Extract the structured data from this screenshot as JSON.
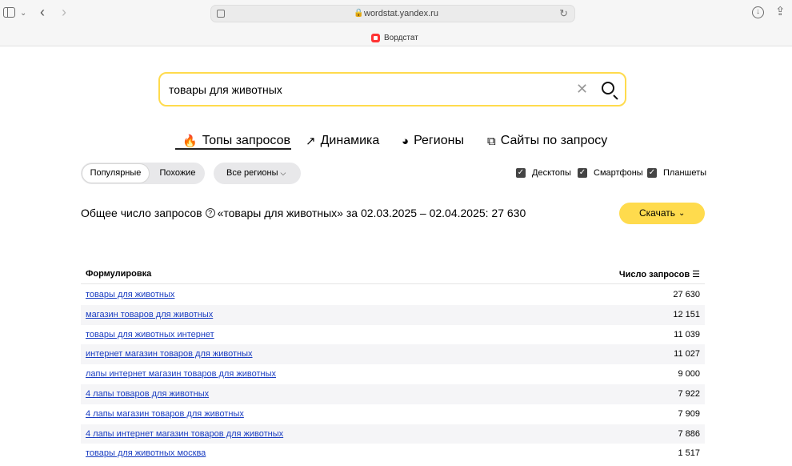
{
  "browser": {
    "url": "wordstat.yandex.ru",
    "tab_title": "Вордстат",
    "lock_glyph": "🔒",
    "reload_glyph": "↻",
    "tabs_chevron_glyph": "⌄",
    "back_glyph": "‹",
    "forward_glyph": "›",
    "download_glyph": "↓",
    "share_glyph": "⇪"
  },
  "search": {
    "query": "товары для животных",
    "clear_glyph": "✕"
  },
  "nav": {
    "tabs": [
      {
        "label": "Топы запросов",
        "icon": "fire-icon",
        "glyph": "🔥",
        "active": true
      },
      {
        "label": "Динамика",
        "icon": "trend-icon",
        "glyph": "↗"
      },
      {
        "label": "Регионы",
        "icon": "globe-icon",
        "glyph": "◕"
      },
      {
        "label": "Сайты по запросу",
        "icon": "external-link-icon",
        "glyph": "⧉"
      }
    ]
  },
  "filters": {
    "popular": "Популярные",
    "similar": "Похожие",
    "region": "Все регионы",
    "region_chevron": "⌵",
    "devices": [
      {
        "label": "Десктопы",
        "checked": true
      },
      {
        "label": "Смартфоны",
        "checked": true
      },
      {
        "label": "Планшеты",
        "checked": true
      }
    ],
    "check_glyph": "✓"
  },
  "summary": {
    "prefix": "Общее число запросов",
    "help_glyph": "?",
    "suffix": "«товары для животных» за 02.03.2025 – 02.04.2025: 27 630"
  },
  "download": {
    "label": "Скачать",
    "chevron": "⌄"
  },
  "table": {
    "col_phrase": "Формулировка",
    "col_count": "Число запросов",
    "sort_glyph": "☰",
    "rows": [
      {
        "phrase": "товары для животных",
        "count": "27 630"
      },
      {
        "phrase": "магазин товаров для животных",
        "count": "12 151"
      },
      {
        "phrase": "товары для животных интернет",
        "count": "11 039"
      },
      {
        "phrase": "интернет магазин товаров для животных",
        "count": "11 027"
      },
      {
        "phrase": "лапы интернет магазин товаров для животных",
        "count": "9 000"
      },
      {
        "phrase": "4 лапы товаров для животных",
        "count": "7 922"
      },
      {
        "phrase": "4 лапы магазин товаров для животных",
        "count": "7 909"
      },
      {
        "phrase": "4 лапы интернет магазин товаров для животных",
        "count": "7 886"
      },
      {
        "phrase": "товары для животных москва",
        "count": "1 517"
      }
    ]
  },
  "colors": {
    "accent_yellow": "#ffdb4d",
    "link_blue": "#1a3dc1"
  }
}
